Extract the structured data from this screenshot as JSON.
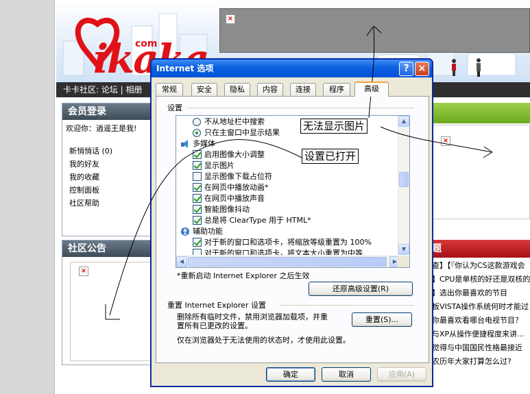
{
  "site": {
    "logo_text": "ikaka",
    "logo_com": "com",
    "nav_text": "卡卡社区: 论坛 | 相册",
    "member_panel": {
      "title": "会员登录",
      "welcome": "欢迎你：逍遥王是我!",
      "links": [
        "新悄悄话 (0)",
        "我的好友",
        "我的收藏",
        "控制面板",
        "社区帮助"
      ]
    },
    "notice_panel": {
      "title": "社区公告"
    },
    "right_red_title": "题",
    "news": [
      "查】【『你认为CS这款游戏会",
      "】CPU是单核的好还是双核的",
      "】选出你最喜欢的节目",
      "板VISTA操作系统何时才能过",
      "你最喜欢看哪台电视节目？",
      "与XP从操作便捷程度来讲...",
      "觉得与中国国民性格最接近",
      "农历年大家打算怎么过?"
    ]
  },
  "dialog": {
    "title": "Internet 选项",
    "help_glyph": "?",
    "close_glyph": "×",
    "tabs": [
      "常规",
      "安全",
      "隐私",
      "内容",
      "连接",
      "程序",
      "高级"
    ],
    "active_tab": "高级",
    "settings_group_label": "设置",
    "list_items": [
      {
        "kind": "radio",
        "checked": false,
        "label": "不从地址栏中搜索"
      },
      {
        "kind": "radio",
        "checked": true,
        "label": "只在主窗口中显示结果"
      },
      {
        "kind": "category",
        "label": "多媒体"
      },
      {
        "kind": "checkbox",
        "checked": true,
        "label": "启用图像大小调整"
      },
      {
        "kind": "checkbox",
        "checked": true,
        "label": "显示图片"
      },
      {
        "kind": "checkbox",
        "checked": false,
        "label": "显示图像下载占位符"
      },
      {
        "kind": "checkbox",
        "checked": true,
        "label": "在网页中播放动画*"
      },
      {
        "kind": "checkbox",
        "checked": true,
        "label": "在网页中播放声音"
      },
      {
        "kind": "checkbox",
        "checked": true,
        "label": "智能图像抖动"
      },
      {
        "kind": "checkbox",
        "checked": true,
        "label": "总是将 ClearType 用于 HTML*"
      },
      {
        "kind": "category",
        "label": "辅助功能"
      },
      {
        "kind": "checkbox",
        "checked": true,
        "label": "对于新的窗口和选项卡，将缩放等级重置为 100%"
      },
      {
        "kind": "checkbox",
        "checked": false,
        "label": "对于新的窗口和选项卡，将文本大小重置为中等"
      }
    ],
    "restart_note": "*重新启动 Internet Explorer 之后生效",
    "restore_button": "还原高级设置(R)",
    "reset_group_label": "重置 Internet Explorer 设置",
    "reset_desc_line1": "删除所有临时文件，禁用浏览器加载项，并重",
    "reset_desc_line2": "置所有已更改的设置。",
    "reset_button": "重置(S)...",
    "reset_note": "仅在浏览器处于无法使用的状态时，才使用此设置。",
    "ok_button": "确定",
    "cancel_button": "取消",
    "apply_button": "应用(A)"
  },
  "annotations": {
    "no_image": "无法显示图片",
    "setting_on": "设置已打开"
  },
  "colors": {
    "title_blue": "#0553d6",
    "check_green": "#21a121",
    "logo_red": "#e01218",
    "nav_dark": "#2f2f2f"
  }
}
